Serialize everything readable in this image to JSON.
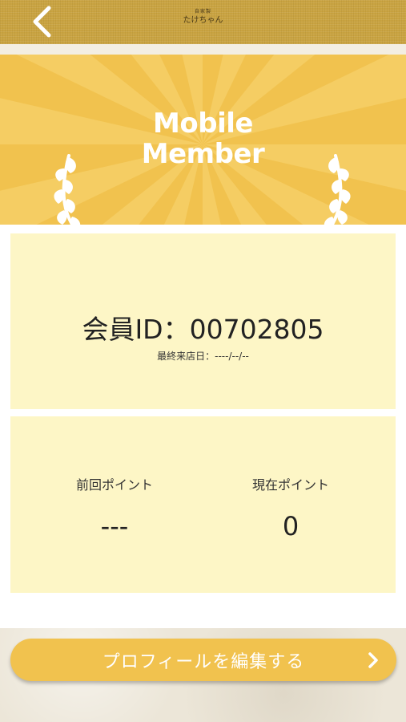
{
  "header": {
    "brand_sub": "自家製",
    "brand_name": "たけちゃん"
  },
  "banner": {
    "title_line1": "Mobile",
    "title_line2": "Member"
  },
  "member": {
    "id_text": "会員ID：00702805",
    "last_visit": "最終来店日：----/--/--"
  },
  "points": {
    "previous_label": "前回ポイント",
    "previous_value": "---",
    "current_label": "現在ポイント",
    "current_value": "0"
  },
  "actions": {
    "edit_profile_label": "プロフィールを編集する"
  },
  "colors": {
    "accent": "#f1c24e",
    "header": "#c9a341",
    "panel": "#fdf6c6"
  }
}
